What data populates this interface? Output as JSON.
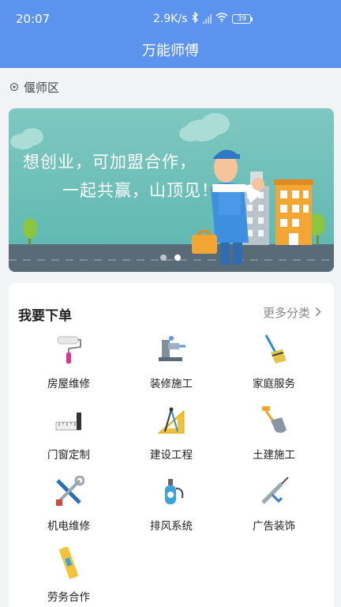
{
  "status_bar": {
    "time": "20:07",
    "network_speed": "2.9K/s",
    "battery": "39"
  },
  "header": {
    "title": "万能师傅"
  },
  "location": {
    "text": "偃师区",
    "icon": "location-pin-icon"
  },
  "banner": {
    "line1": "想创业，可加盟合作，",
    "line2": "一起共赢，山顶见！",
    "slides_total": 2,
    "active_slide": 2
  },
  "order_section": {
    "title": "我要下单",
    "more_label": "更多分类",
    "categories": [
      {
        "label": "房屋维修",
        "icon": "paint-roller-icon"
      },
      {
        "label": "装修施工",
        "icon": "bench-vise-icon"
      },
      {
        "label": "家庭服务",
        "icon": "broom-icon"
      },
      {
        "label": "门窗定制",
        "icon": "ruler-icon"
      },
      {
        "label": "建设工程",
        "icon": "compass-triangle-icon"
      },
      {
        "label": "土建施工",
        "icon": "shovel-icon"
      },
      {
        "label": "机电维修",
        "icon": "screwdriver-wrench-icon"
      },
      {
        "label": "排风系统",
        "icon": "sprayer-icon"
      },
      {
        "label": "广告装饰",
        "icon": "caulk-gun-icon"
      },
      {
        "label": "劳务合作",
        "icon": "spirit-level-icon"
      }
    ]
  }
}
